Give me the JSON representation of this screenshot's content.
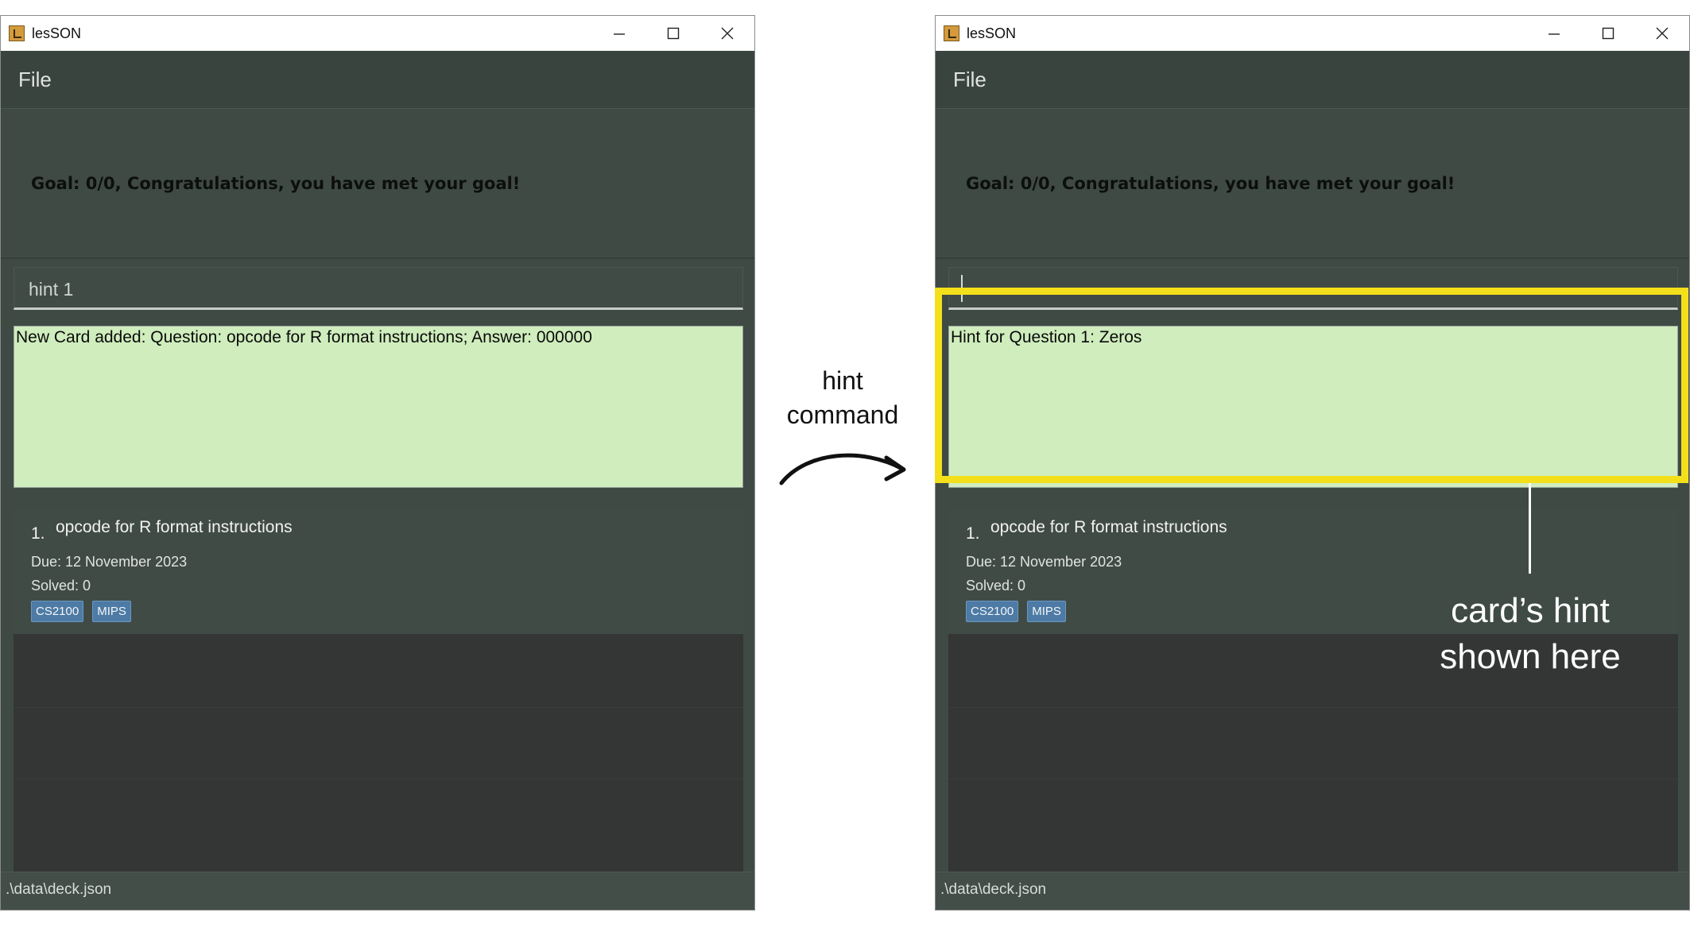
{
  "windows": [
    {
      "title": "lesSON",
      "menu": {
        "file_label": "File"
      },
      "goal_text": "Goal: 0/0, Congratulations, you have met your goal!",
      "command_input": {
        "value": "hint 1"
      },
      "result_text": "New Card added: Question: opcode for R format instructions; Answer: 000000",
      "cards": [
        {
          "index": "1.",
          "question": "opcode for R format instructions",
          "due": "Due: 12 November 2023",
          "solved": "Solved: 0",
          "tags": [
            "CS2100",
            "MIPS"
          ]
        }
      ],
      "status_path": ".\\data\\deck.json"
    },
    {
      "title": "lesSON",
      "menu": {
        "file_label": "File"
      },
      "goal_text": "Goal: 0/0, Congratulations, you have met your goal!",
      "command_input": {
        "value": ""
      },
      "result_text": "Hint for Question 1: Zeros",
      "cards": [
        {
          "index": "1.",
          "question": "opcode for R format instructions",
          "due": "Due: 12 November 2023",
          "solved": "Solved: 0",
          "tags": [
            "CS2100",
            "MIPS"
          ]
        }
      ],
      "status_path": ".\\data\\deck.json"
    }
  ],
  "annotations": {
    "transition_line1": "hint",
    "transition_line2": "command",
    "callout_line1": "card’s hint",
    "callout_line2": "shown here",
    "highlight_color": "#f4e01a"
  },
  "colors": {
    "window_bg": "#3f4a45",
    "result_bg": "#cfedbd",
    "list_bg": "#333635",
    "tag_bg": "#4d7ba5"
  },
  "icons": [
    "app-icon",
    "minimize-icon",
    "maximize-icon",
    "close-icon"
  ]
}
